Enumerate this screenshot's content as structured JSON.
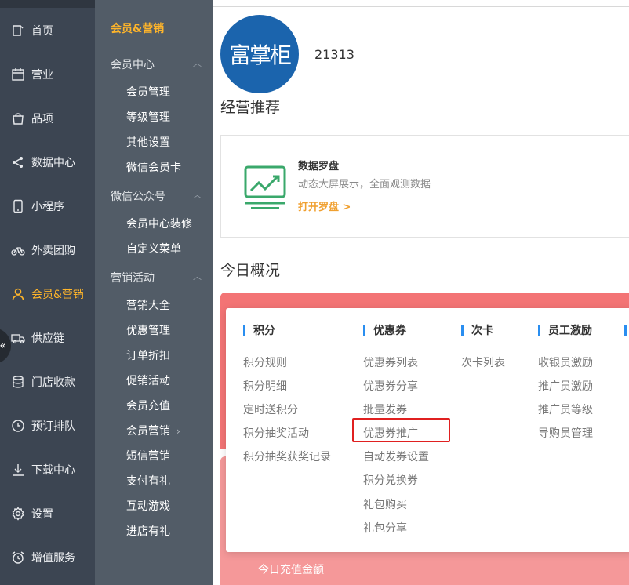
{
  "nav": {
    "items": [
      {
        "label": "首页",
        "icon": "home-icon"
      },
      {
        "label": "营业",
        "icon": "calendar-icon"
      },
      {
        "label": "品项",
        "icon": "bag-icon"
      },
      {
        "label": "数据中心",
        "icon": "share-icon"
      },
      {
        "label": "小程序",
        "icon": "phone-icon"
      },
      {
        "label": "外卖团购",
        "icon": "bike-icon"
      },
      {
        "label": "会员&营销",
        "icon": "user-icon"
      },
      {
        "label": "供应链",
        "icon": "truck-icon"
      },
      {
        "label": "门店收款",
        "icon": "coins-icon"
      },
      {
        "label": "预订排队",
        "icon": "clock-icon"
      },
      {
        "label": "下载中心",
        "icon": "download-icon"
      },
      {
        "label": "设置",
        "icon": "gear-icon"
      },
      {
        "label": "增值服务",
        "icon": "alarm-icon"
      }
    ],
    "active_index": 6,
    "collapse_glyph": "«",
    "active_color": "#ffb52a"
  },
  "subnav": {
    "title": "会员&营销",
    "groups": [
      {
        "label": "会员中心",
        "caret": "︿"
      },
      {
        "label": "微信公众号",
        "caret": "︿"
      },
      {
        "label": "营销活动",
        "caret": "︿"
      }
    ],
    "items": [
      "会员管理",
      "等级管理",
      "其他设置",
      "微信会员卡",
      "会员中心装修",
      "自定义菜单",
      "营销大全",
      "优惠管理",
      "订单折扣",
      "促销活动",
      "会员充值",
      "会员营销",
      "短信营销",
      "支付有礼",
      "互动游戏",
      "进店有礼"
    ],
    "submenu_arrow": "›"
  },
  "content": {
    "logo_text": "富掌柜",
    "shop_id": "21313",
    "section_recommend": "经营推荐",
    "card": {
      "title": "数据罗盘",
      "desc": "动态大屏展示，全面观测数据",
      "link": "打开罗盘 >"
    },
    "section_today": "今日概况",
    "today_label": "今日充值金额"
  },
  "dropdown": {
    "columns": [
      {
        "header": "积分",
        "items": [
          "积分规则",
          "积分明细",
          "定时送积分",
          "积分抽奖活动",
          "积分抽奖获奖记录"
        ]
      },
      {
        "header": "优惠券",
        "items": [
          "优惠券列表",
          "优惠券分享",
          "批量发券",
          "优惠券推广",
          "自动发券设置",
          "积分兑换券",
          "礼包购买",
          "礼包分享"
        ]
      },
      {
        "header": "次卡",
        "items": [
          "次卡列表"
        ]
      },
      {
        "header": "员工激励",
        "items": [
          "收银员激励",
          "推广员激励",
          "推广员等级",
          "导购员管理"
        ]
      }
    ],
    "accent_color": "#2a8ef0",
    "highlight_color": "#e02020"
  }
}
